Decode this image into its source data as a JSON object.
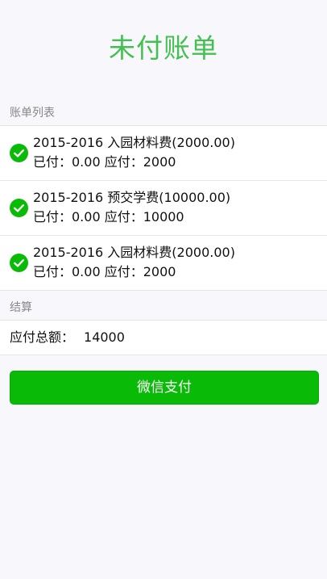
{
  "page_title": "未付账单",
  "bill_section": {
    "header": "账单列表",
    "items": [
      {
        "title": "2015-2016 入园材料费(2000.00)",
        "detail": "已付：0.00 应付：2000"
      },
      {
        "title": "2015-2016 预交学费(10000.00)",
        "detail": "已付：0.00 应付：10000"
      },
      {
        "title": "2015-2016 入园材料费(2000.00)",
        "detail": "已付：0.00 应付：2000"
      }
    ]
  },
  "settle_section": {
    "header": "结算",
    "total_label": "应付总额：",
    "total_value": "14000"
  },
  "pay_button_label": "微信支付",
  "icons": {
    "item_status": "check-circle-icon"
  },
  "colors": {
    "title": "#43c051",
    "accent": "#09bb07",
    "background": "#f8f7fc"
  }
}
